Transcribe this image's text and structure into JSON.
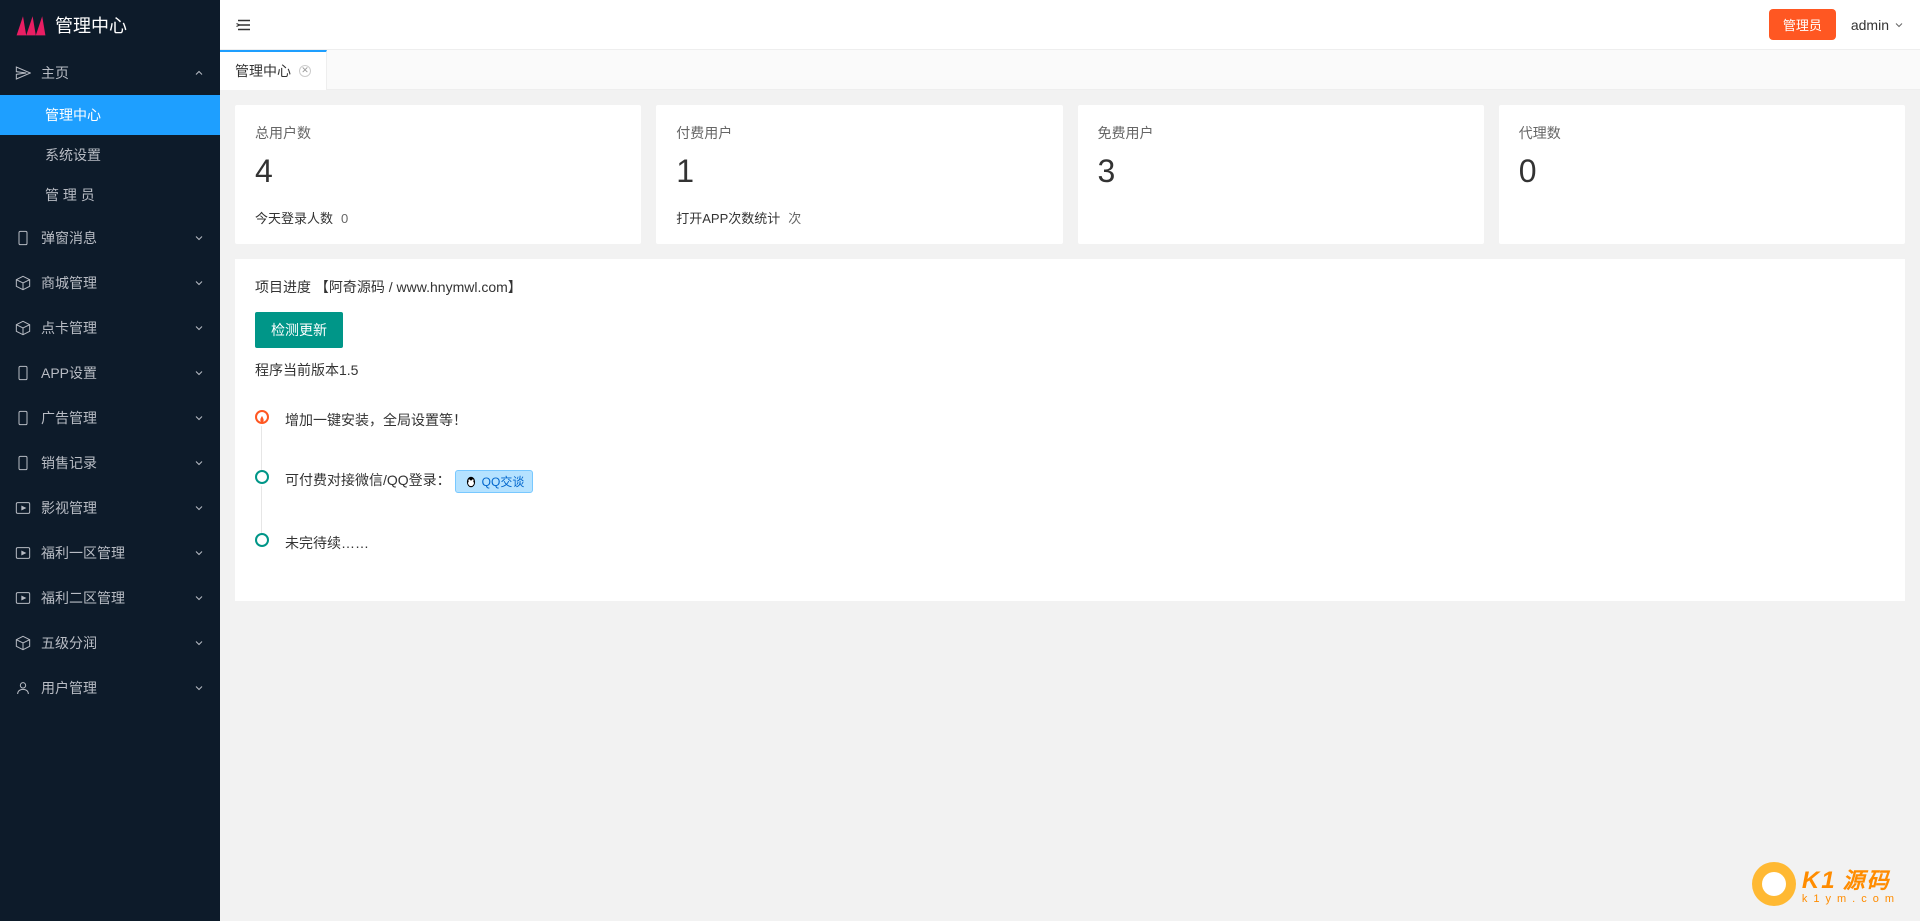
{
  "logo": {
    "text": "管理中心"
  },
  "sidebar": {
    "items": [
      {
        "label": "主页",
        "icon": "send",
        "expanded": true,
        "sub": [
          {
            "label": "管理中心",
            "active": true
          },
          {
            "label": "系统设置"
          },
          {
            "label": "管 理 员"
          }
        ]
      },
      {
        "label": "弹窗消息",
        "icon": "phone"
      },
      {
        "label": "商城管理",
        "icon": "box"
      },
      {
        "label": "点卡管理",
        "icon": "box"
      },
      {
        "label": "APP设置",
        "icon": "phone"
      },
      {
        "label": "广告管理",
        "icon": "phone"
      },
      {
        "label": "销售记录",
        "icon": "phone"
      },
      {
        "label": "影视管理",
        "icon": "play"
      },
      {
        "label": "福利一区管理",
        "icon": "play"
      },
      {
        "label": "福利二区管理",
        "icon": "play"
      },
      {
        "label": "五级分润",
        "icon": "box"
      },
      {
        "label": "用户管理",
        "icon": "user"
      }
    ]
  },
  "header": {
    "badge": "管理员",
    "user": "admin"
  },
  "tab": {
    "title": "管理中心"
  },
  "stats": [
    {
      "label": "总用户数",
      "value": "4",
      "sub_label": "今天登录人数",
      "sub_value": "0"
    },
    {
      "label": "付费用户",
      "value": "1",
      "sub_label": "打开APP次数统计",
      "sub_value": "次"
    },
    {
      "label": "免费用户",
      "value": "3",
      "sub_label": "",
      "sub_value": ""
    },
    {
      "label": "代理数",
      "value": "0",
      "sub_label": "",
      "sub_value": ""
    }
  ],
  "project": {
    "title": "项目进度 【阿奇源码 / www.hnymwl.com】",
    "check_btn": "检测更新",
    "version": "程序当前版本1.5"
  },
  "timeline": [
    {
      "text": "增加一键安装，全局设置等！",
      "style": "fire"
    },
    {
      "text": "可付费对接微信/QQ登录：",
      "qq": "QQ交谈"
    },
    {
      "text": "未完待续……"
    }
  ],
  "watermark": {
    "brand": "K1",
    "chars": "源码",
    "sub": "k1ym.com"
  }
}
